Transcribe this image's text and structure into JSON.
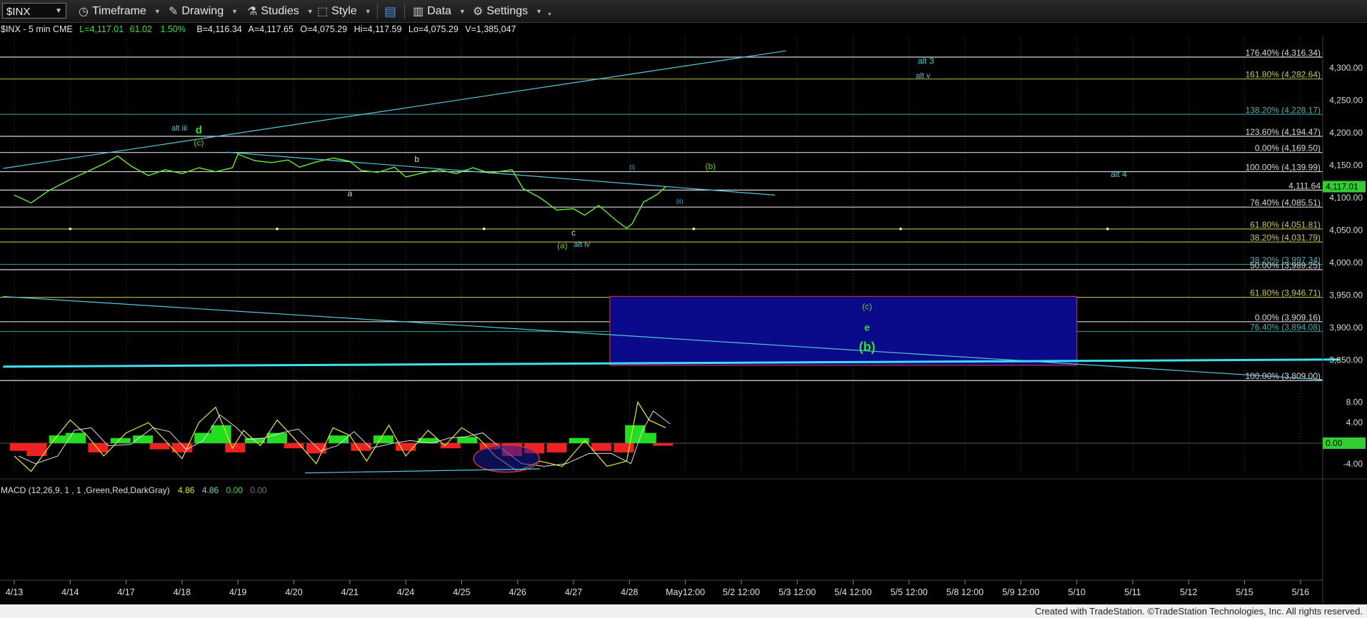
{
  "toolbar": {
    "symbol": "$INX",
    "items": [
      {
        "name": "timeframe",
        "label": "Timeframe",
        "icon": "clock-icon"
      },
      {
        "name": "drawing",
        "label": "Drawing",
        "icon": "pencil-icon"
      },
      {
        "name": "studies",
        "label": "Studies",
        "icon": "flask-icon"
      },
      {
        "name": "style",
        "label": "Style",
        "icon": "style-icon"
      },
      {
        "name": "data",
        "label": "Data",
        "icon": "bar-chart-icon"
      },
      {
        "name": "settings",
        "label": "Settings",
        "icon": "gear-icon"
      }
    ]
  },
  "header": {
    "symbol": "$INX - 5 min  CME",
    "last": "L=4,117.01",
    "change": "61.02",
    "pct": "1.50%",
    "bid": "B=4,116.34",
    "ask": "A=4,117.65",
    "open": "O=4,075.29",
    "high": "Hi=4,117.59",
    "low": "Lo=4,075.29",
    "volume": "V=1,385,047"
  },
  "macd_header": {
    "label": "MACD (12,26,9, 1 , 1 ,Green,Red,DarkGray)",
    "v1": "4.86",
    "v2": "4.86",
    "v3": "0.00",
    "v4": "0.00"
  },
  "colors": {
    "price": "#66ee33",
    "cyan": "#55c8d8",
    "white_line": "#d8d8d8",
    "fib_teal": "#4fb0b0",
    "fib_olive": "#a9a94a",
    "box_fill": "#0a0a8a",
    "box_border": "#d02a2a",
    "macd_green": "#22dd22",
    "macd_red": "#ee2222",
    "price_tag": "#33cc33"
  },
  "chart_data": {
    "type": "line",
    "title": "",
    "ylim": [
      3809,
      4335
    ],
    "x_ticks": [
      "4/13",
      "4/14",
      "4/17",
      "4/18",
      "4/19",
      "4/20",
      "4/21",
      "4/24",
      "4/25",
      "4/26",
      "4/27",
      "4/28",
      "May12:00",
      "5/2 12:00",
      "5/3 12:00",
      "5/4 12:00",
      "5/5 12:00",
      "5/8 12:00",
      "5/9 12:00",
      "5/10",
      "5/11",
      "5/12",
      "5/15",
      "5/16"
    ],
    "y_ticks": [
      "4,300.00",
      "4,250.00",
      "4,200.00",
      "4,150.00",
      "4,100.00",
      "4,050.00",
      "4,000.00",
      "3,950.00",
      "3,900.00",
      "3,850.00"
    ],
    "last_price": "4,117.01",
    "macd_ticks": [
      "8.00",
      "4.00",
      "0.00",
      "-4.00"
    ],
    "macd_last": "0.00",
    "price_series": [
      [
        0,
        4104
      ],
      [
        0.3,
        4092
      ],
      [
        0.6,
        4110
      ],
      [
        1.0,
        4128
      ],
      [
        1.3,
        4140
      ],
      [
        1.6,
        4152
      ],
      [
        1.85,
        4164
      ],
      [
        2.1,
        4148
      ],
      [
        2.4,
        4134
      ],
      [
        2.7,
        4143
      ],
      [
        3.0,
        4137
      ],
      [
        3.3,
        4146
      ],
      [
        3.6,
        4140
      ],
      [
        3.9,
        4146
      ],
      [
        4.0,
        4167
      ],
      [
        4.3,
        4157
      ],
      [
        4.6,
        4154
      ],
      [
        4.9,
        4158
      ],
      [
        5.1,
        4147
      ],
      [
        5.4,
        4155
      ],
      [
        5.7,
        4161
      ],
      [
        6.0,
        4156
      ],
      [
        6.2,
        4142
      ],
      [
        6.5,
        4139
      ],
      [
        6.8,
        4147
      ],
      [
        7.0,
        4132
      ],
      [
        7.3,
        4138
      ],
      [
        7.6,
        4143
      ],
      [
        7.9,
        4137
      ],
      [
        8.2,
        4146
      ],
      [
        8.5,
        4138
      ],
      [
        8.9,
        4143
      ],
      [
        9.1,
        4114
      ],
      [
        9.4,
        4100
      ],
      [
        9.7,
        4081
      ],
      [
        10.0,
        4083
      ],
      [
        10.2,
        4073
      ],
      [
        10.45,
        4088
      ],
      [
        10.75,
        4066
      ],
      [
        10.95,
        4053
      ],
      [
        11.05,
        4060
      ],
      [
        11.25,
        4093
      ],
      [
        11.5,
        4105
      ],
      [
        11.65,
        4117
      ]
    ],
    "macd_series": [
      [
        0,
        -2.5
      ],
      [
        0.3,
        -5.5
      ],
      [
        0.7,
        0.5
      ],
      [
        1.0,
        4.5
      ],
      [
        1.3,
        1.5
      ],
      [
        1.6,
        -2.5
      ],
      [
        2.0,
        2.0
      ],
      [
        2.4,
        4.0
      ],
      [
        2.7,
        0.5
      ],
      [
        3.0,
        -3.0
      ],
      [
        3.3,
        4.0
      ],
      [
        3.6,
        7.0
      ],
      [
        3.9,
        -1.0
      ],
      [
        4.1,
        2.5
      ],
      [
        4.4,
        -0.5
      ],
      [
        4.7,
        4.5
      ],
      [
        5.0,
        1.0
      ],
      [
        5.4,
        -4.0
      ],
      [
        5.7,
        3.0
      ],
      [
        6.0,
        1.5
      ],
      [
        6.3,
        -3.5
      ],
      [
        6.7,
        3.5
      ],
      [
        7.0,
        -2.5
      ],
      [
        7.4,
        2.5
      ],
      [
        7.7,
        -0.5
      ],
      [
        8.0,
        3.0
      ],
      [
        8.3,
        1.0
      ],
      [
        8.6,
        -2.5
      ],
      [
        9.0,
        -5.5
      ],
      [
        9.4,
        -3.5
      ],
      [
        9.8,
        -4.5
      ],
      [
        10.2,
        0.5
      ],
      [
        10.6,
        -4.5
      ],
      [
        10.95,
        -3.5
      ],
      [
        11.15,
        8.0
      ],
      [
        11.35,
        4.5
      ],
      [
        11.65,
        3.0
      ]
    ],
    "macd_bars": [
      [
        0.1,
        -1.5
      ],
      [
        0.4,
        -2.5
      ],
      [
        0.8,
        1.5
      ],
      [
        1.1,
        2.0
      ],
      [
        1.5,
        -1.8
      ],
      [
        1.9,
        1.0
      ],
      [
        2.3,
        1.5
      ],
      [
        2.6,
        -1.2
      ],
      [
        3.0,
        -1.8
      ],
      [
        3.4,
        2.0
      ],
      [
        3.7,
        3.5
      ],
      [
        3.95,
        -1.8
      ],
      [
        4.3,
        1.0
      ],
      [
        4.7,
        2.0
      ],
      [
        5.0,
        -1.0
      ],
      [
        5.4,
        -2.0
      ],
      [
        5.8,
        1.5
      ],
      [
        6.2,
        -1.5
      ],
      [
        6.6,
        1.5
      ],
      [
        7.0,
        -1.5
      ],
      [
        7.4,
        1.0
      ],
      [
        7.8,
        -1.0
      ],
      [
        8.1,
        1.2
      ],
      [
        8.5,
        -1.2
      ],
      [
        8.9,
        -2.5
      ],
      [
        9.3,
        -2.0
      ],
      [
        9.7,
        -1.8
      ],
      [
        10.1,
        1.0
      ],
      [
        10.5,
        -1.5
      ],
      [
        10.9,
        -1.8
      ],
      [
        11.1,
        3.5
      ],
      [
        11.3,
        2.0
      ],
      [
        11.6,
        -0.5
      ]
    ],
    "levels": [
      {
        "price": 4316.34,
        "label": "176.40% (4,316.34)",
        "color": "#d8d8d8",
        "label_color": "#d8d8d8"
      },
      {
        "price": 4282.64,
        "label": "161.80% (4,282.64)",
        "color": "#a9a94a",
        "label_color": "#c8c86a"
      },
      {
        "price": 4228.17,
        "label": "138.20% (4,228.17)",
        "color": "#2d8a8a",
        "label_color": "#4fb0b0"
      },
      {
        "price": 4194.47,
        "label": "123.60% (4,194.47)",
        "color": "#d8d8d8",
        "label_color": "#d8d8d8"
      },
      {
        "price": 4169.5,
        "label": "0.00% (4,169.50)",
        "color": "#d8d8d8",
        "label_color": "#d8d8d8"
      },
      {
        "price": 4139.99,
        "label": "100.00% (4,139.99)",
        "color": "#d8d8d8",
        "label_color": "#d8d8d8"
      },
      {
        "price": 4111.64,
        "label": "4,111.64",
        "color": "#d8d8d8",
        "label_color": "#d8d8d8"
      },
      {
        "price": 4085.51,
        "label": "76.40% (4,085.51)",
        "color": "#d8d8d8",
        "label_color": "#d8d8d8"
      },
      {
        "price": 4051.81,
        "label": "61.80% (4,051.81)",
        "color": "#a9a94a",
        "label_color": "#c8c86a"
      },
      {
        "price": 4031.79,
        "label": "38.20% (4,031.79)",
        "color": "#a9a94a",
        "label_color": "#c8c86a"
      },
      {
        "price": 3997.34,
        "label": "38.20% (3,997.34)",
        "color": "#2d8a8a",
        "label_color": "#4fb0b0"
      },
      {
        "price": 3989.25,
        "label": "50.00% (3,989.25)",
        "color": "#d8d8d8",
        "label_color": "#d8d8d8"
      },
      {
        "price": 3946.71,
        "label": "61.80% (3,946.71)",
        "color": "#a9a94a",
        "label_color": "#c8c86a"
      },
      {
        "price": 3909.16,
        "label": "0.00% (3,909.16)",
        "color": "#d8d8d8",
        "label_color": "#d8d8d8"
      },
      {
        "price": 3894.08,
        "label": "76.40% (3,894.08)",
        "color": "#2d8a8a",
        "label_color": "#4fb0b0"
      },
      {
        "price": 3818.61,
        "label": "100.00% (3,809.00)",
        "color": "#d8d8d8",
        "label_color": "#d8d8d8"
      }
    ],
    "trendlines": [
      {
        "from": [
          -0.2,
          4145
        ],
        "to": [
          13.8,
          4326
        ],
        "color": "#55c8d8",
        "width": 1.2
      },
      {
        "from": [
          3.8,
          4170
        ],
        "to": [
          13.6,
          4104
        ],
        "color": "#55c8d8",
        "width": 1.2
      },
      {
        "from": [
          -0.2,
          3948
        ],
        "to": [
          23.4,
          3820
        ],
        "color": "#55c8d8",
        "width": 1.2
      },
      {
        "from": [
          -0.2,
          3840
        ],
        "to": [
          23.7,
          3851
        ],
        "color": "#3ee0f0",
        "width": 3
      }
    ],
    "target_box": {
      "x0": 10.65,
      "x1": 19.0,
      "top": 3948,
      "bottom": 3842
    },
    "dots": [
      {
        "x": 1.0,
        "price": 4052
      },
      {
        "x": 4.7,
        "price": 4052
      },
      {
        "x": 8.4,
        "price": 4052
      },
      {
        "x": 12.15,
        "price": 4052
      },
      {
        "x": 15.85,
        "price": 4052
      },
      {
        "x": 19.55,
        "price": 4052
      }
    ],
    "annotations": [
      {
        "text": "alt iii",
        "x": 2.95,
        "price": 4203,
        "color": "#55c8d8",
        "size": 11
      },
      {
        "text": "d",
        "x": 3.3,
        "price": 4199,
        "color": "#33dd33",
        "size": 15,
        "bold": true
      },
      {
        "text": "(c)",
        "x": 3.3,
        "price": 4180,
        "color": "#66cc33",
        "size": 12
      },
      {
        "text": "b",
        "x": 7.2,
        "price": 4155,
        "color": "#d8d8d8",
        "size": 12
      },
      {
        "text": "a",
        "x": 6.0,
        "price": 4102,
        "color": "#d8d8d8",
        "size": 12
      },
      {
        "text": "c",
        "x": 10.0,
        "price": 4042,
        "color": "#d8d8d8",
        "size": 12
      },
      {
        "text": "(a)",
        "x": 9.8,
        "price": 4022,
        "color": "#66cc33",
        "size": 12
      },
      {
        "text": "alt iv",
        "x": 10.15,
        "price": 4024,
        "color": "#55c8d8",
        "size": 11
      },
      {
        "text": "(i)",
        "x": 11.05,
        "price": 4144,
        "color": "#4fa8c8",
        "size": 9
      },
      {
        "text": "(b)",
        "x": 12.45,
        "price": 4144,
        "color": "#66cc33",
        "size": 12
      },
      {
        "text": "(ii)",
        "x": 11.9,
        "price": 4091,
        "color": "#4fa8c8",
        "size": 9
      },
      {
        "text": "alt 3",
        "x": 16.3,
        "price": 4306,
        "color": "#55c8d8",
        "size": 12
      },
      {
        "text": "alt v",
        "x": 16.25,
        "price": 4284,
        "color": "#55c8d8",
        "size": 11
      },
      {
        "text": "alt 4",
        "x": 19.75,
        "price": 4132,
        "color": "#55c8d8",
        "size": 12
      },
      {
        "text": "(c)",
        "x": 15.25,
        "price": 3928,
        "color": "#66cc33",
        "size": 12
      },
      {
        "text": "e",
        "x": 15.25,
        "price": 3895,
        "color": "#33dd33",
        "size": 14,
        "bold": true
      },
      {
        "text": "(b)",
        "x": 15.25,
        "price": 3864,
        "color": "#33dd33",
        "size": 18,
        "bold": true
      }
    ]
  },
  "footer": {
    "credit": "Created with TradeStation. ©TradeStation Technologies, Inc. All rights reserved."
  }
}
